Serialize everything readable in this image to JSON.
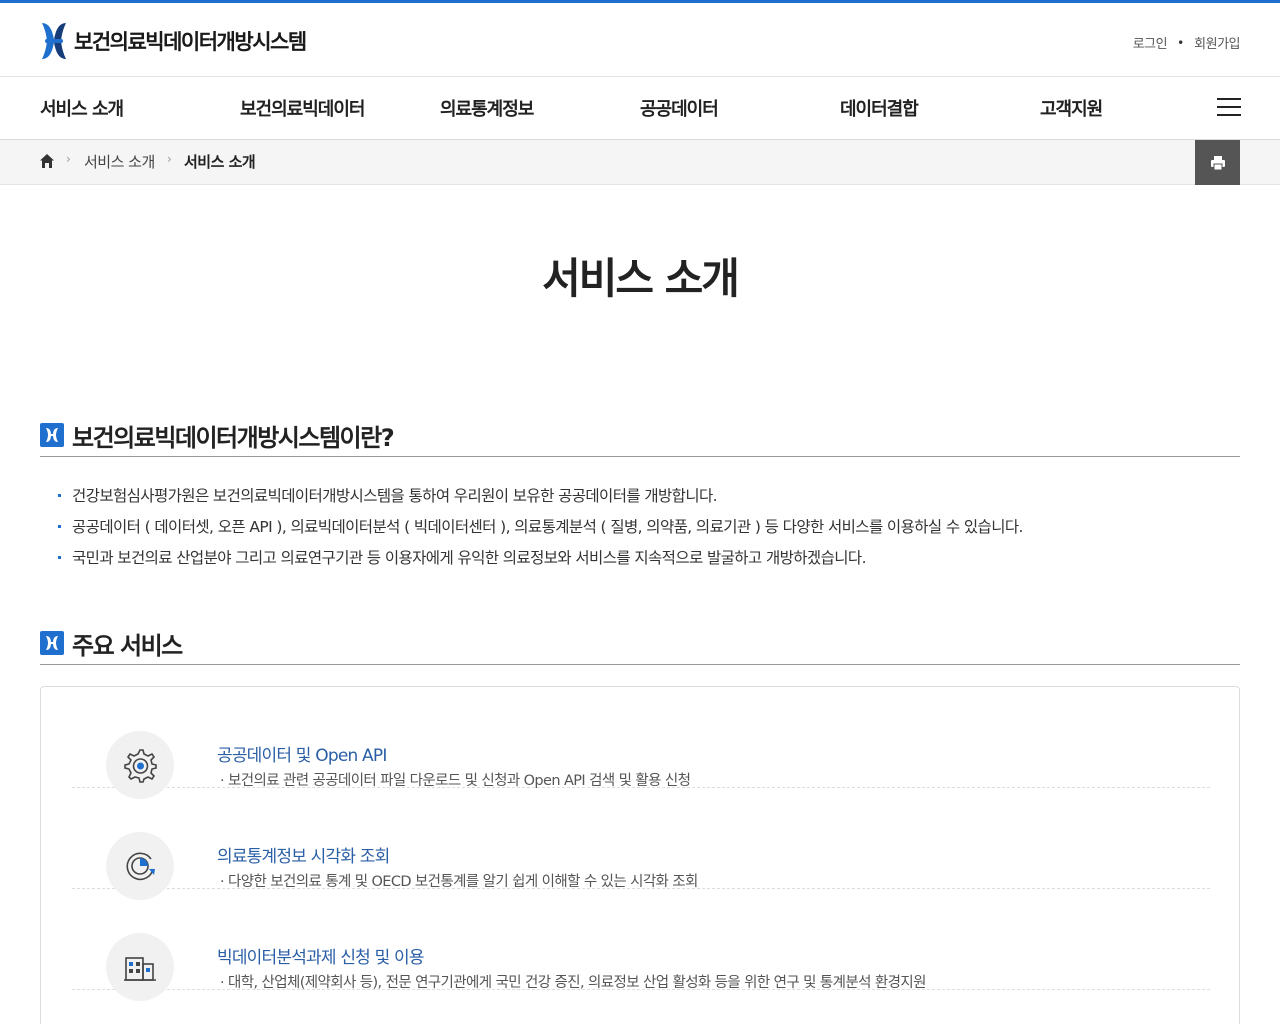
{
  "colors": {
    "accent": "#1f6fce",
    "link": "#2a5ea6",
    "print_bg": "#555555"
  },
  "header": {
    "logo_text": "보건의료빅데이터개방시스템",
    "login": "로그인",
    "signup": "회원가입"
  },
  "gnb": {
    "items": [
      "서비스 소개",
      "보건의료빅데이터",
      "의료통계정보",
      "공공데이터",
      "데이터결합",
      "고객지원"
    ],
    "menu_icon": "hamburger-menu-icon"
  },
  "breadcrumb": {
    "home_icon": "home-icon",
    "level1": "서비스 소개",
    "level2": "서비스 소개",
    "print_icon": "printer-icon"
  },
  "page_title": "서비스 소개",
  "intro": {
    "heading": "보건의료빅데이터개방시스템이란?",
    "bullets": [
      "건강보험심사평가원은 보건의료빅데이터개방시스템을 통하여 우리원이 보유한 공공데이터를 개방합니다.",
      "공공데이터 ( 데이터셋, 오픈 API ), 의료빅데이터분석 ( 빅데이터센터 ), 의료통계분석 ( 질병, 의약품, 의료기관 ) 등 다양한 서비스를 이용하실 수 있습니다.",
      "국민과 보건의료 산업분야 그리고 의료연구기관 등 이용자에게 유익한 의료정보와 서비스를 지속적으로 발굴하고 개방하겠습니다."
    ]
  },
  "services": {
    "heading": "주요 서비스",
    "items": [
      {
        "icon": "gear-icon",
        "title": "공공데이터 및 Open API",
        "desc": "· 보건의료 관련 공공데이터 파일 다운로드 및 신청과 Open API 검색 및 활용 신청"
      },
      {
        "icon": "chart-refresh-icon",
        "title": "의료통계정보 시각화 조회",
        "desc": "· 다양한 보건의료 통계 및 OECD 보건통계를 알기 쉽게 이해할 수 있는 시각화 조회"
      },
      {
        "icon": "building-icon",
        "title": "빅데이터분석과제 신청 및 이용",
        "desc": "· 대학, 산업체(제약회사 등), 전문 연구기관에게 국민 건강 증진, 의료정보 산업 활성화 등을 위한 연구 및 통계분석 환경지원"
      }
    ]
  }
}
